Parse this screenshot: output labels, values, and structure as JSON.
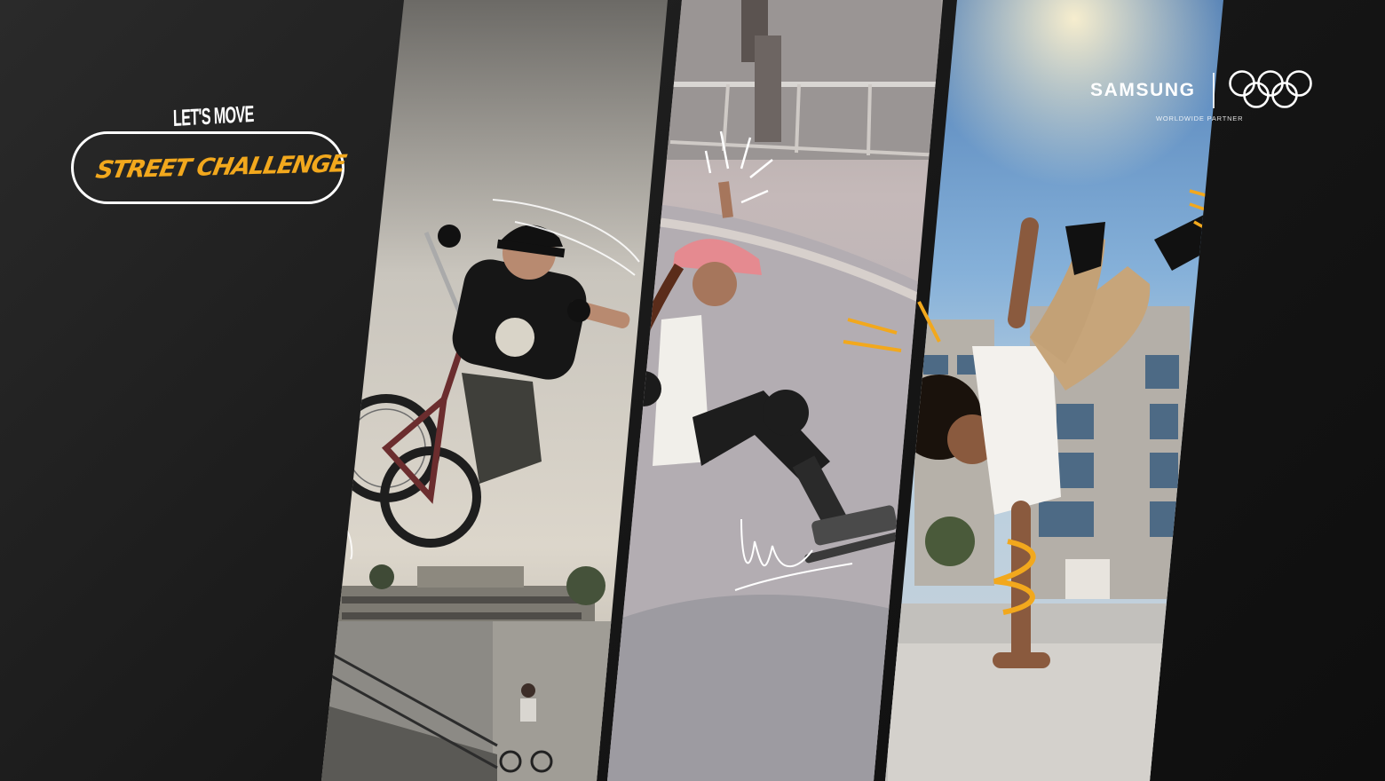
{
  "promo": {
    "headline_top": "LET'S MOVE",
    "headline_main": "STREET CHALLENGE"
  },
  "sponsor": {
    "brand": "SAMSUNG",
    "caption": "WORLDWIDE PARTNER",
    "emblem": "olympic-rings-icon"
  },
  "photos": [
    {
      "subject": "bmx-rider",
      "scene": "skatepark"
    },
    {
      "subject": "skateboarder",
      "scene": "skate-bowl"
    },
    {
      "subject": "breakdancer",
      "scene": "urban-plaza"
    }
  ],
  "colors": {
    "background": "#161616",
    "accent": "#f2a81d",
    "text": "#ffffff",
    "divider": "#1a1a1a"
  }
}
